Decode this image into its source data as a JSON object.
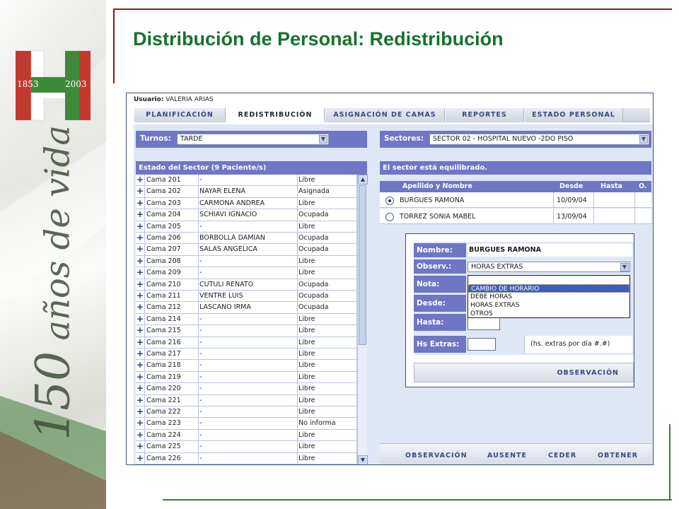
{
  "page": {
    "title": "Distribución de Personal: Redistribución"
  },
  "banner": {
    "years_left": "1853",
    "years_right": "2003",
    "caption_number": "150",
    "caption_text": "años de vida"
  },
  "app": {
    "user_label": "Usuario:",
    "user_name": "VALERIA ARIAS",
    "tabs": [
      {
        "label": "PLANIFICACIÓN",
        "active": false
      },
      {
        "label": "REDISTRIBUCIÓN",
        "active": true
      },
      {
        "label": "ASIGNACIÓN DE CAMAS",
        "active": false
      },
      {
        "label": "REPORTES",
        "active": false
      },
      {
        "label": "ESTADO PERSONAL",
        "active": false
      }
    ],
    "turnos_label": "Turnos:",
    "turnos_value": "TARDE",
    "sectores_label": "Sectores:",
    "sectores_value": "SECTOR 02 - HOSPITAL NUEVO -2DO PISO",
    "sector_status_title": "Estado del Sector (9 Paciente/s)",
    "balance_message": "El sector está equilibrado.",
    "beds": [
      {
        "cama": "Cama 201",
        "nombre": "-",
        "estado": "Libre"
      },
      {
        "cama": "Cama 202",
        "nombre": "NAYAR ELENA",
        "estado": "Asignada"
      },
      {
        "cama": "Cama 203",
        "nombre": "CARMONA ANDREA",
        "estado": "Libre"
      },
      {
        "cama": "Cama 204",
        "nombre": "SCHIAVI IGNACIO",
        "estado": "Ocupada"
      },
      {
        "cama": "Cama 205",
        "nombre": "-",
        "estado": "Libre"
      },
      {
        "cama": "Cama 206",
        "nombre": "BORBOLLA DAMIAN",
        "estado": "Ocupada"
      },
      {
        "cama": "Cama 207",
        "nombre": "SALAS ANGELICA",
        "estado": "Ocupada"
      },
      {
        "cama": "Cama 208",
        "nombre": "-",
        "estado": "Libre"
      },
      {
        "cama": "Cama 209",
        "nombre": "-",
        "estado": "Libre"
      },
      {
        "cama": "Cama 210",
        "nombre": "CUTULI RENATO",
        "estado": "Ocupada"
      },
      {
        "cama": "Cama 211",
        "nombre": "VENTRE LUIS",
        "estado": "Ocupada"
      },
      {
        "cama": "Cama 212",
        "nombre": "LASCANO IRMA",
        "estado": "Ocupada"
      },
      {
        "cama": "Cama 214",
        "nombre": "-",
        "estado": "Libre"
      },
      {
        "cama": "Cama 215",
        "nombre": "-",
        "estado": "Libre"
      },
      {
        "cama": "Cama 216",
        "nombre": "-",
        "estado": "Libre"
      },
      {
        "cama": "Cama 217",
        "nombre": "-",
        "estado": "Libre"
      },
      {
        "cama": "Cama 218",
        "nombre": "-",
        "estado": "Libre"
      },
      {
        "cama": "Cama 219",
        "nombre": "-",
        "estado": "Libre"
      },
      {
        "cama": "Cama 220",
        "nombre": "-",
        "estado": "Libre"
      },
      {
        "cama": "Cama 221",
        "nombre": "-",
        "estado": "Libre"
      },
      {
        "cama": "Cama 222",
        "nombre": "-",
        "estado": "Libre"
      },
      {
        "cama": "Cama 223",
        "nombre": "-",
        "estado": "No informa"
      },
      {
        "cama": "Cama 224",
        "nombre": "-",
        "estado": "Libre"
      },
      {
        "cama": "Cama 225",
        "nombre": "-",
        "estado": "Libre"
      },
      {
        "cama": "Cama 226",
        "nombre": "-",
        "estado": "Libre"
      }
    ],
    "staff_columns": [
      "Apellido y Nombre",
      "Desde",
      "Hasta",
      "O."
    ],
    "staff": [
      {
        "nombre": "BURGUES RAMONA",
        "desde": "10/09/04",
        "hasta": "",
        "o": "",
        "selected": true
      },
      {
        "nombre": "TORREZ SONIA MABEL",
        "desde": "13/09/04",
        "hasta": "",
        "o": "",
        "selected": false
      }
    ],
    "dialog": {
      "nombre_label": "Nombre:",
      "nombre_value": "BURGUES RAMONA",
      "observ_label": "Observ.:",
      "observ_value": "HORAS EXTRAS",
      "nota_label": "Nota:",
      "desde_label": "Desde:",
      "hasta_label": "Hasta:",
      "hs_extras_label": "Hs Extras:",
      "hs_extras_hint": "(hs. extras por día #.#)",
      "options": [
        "CAMBIO DE HORARIO",
        "DEBE HORAS",
        "HORAS EXTRAS",
        "OTROS"
      ],
      "selected_option": "CAMBIO DE HORARIO",
      "button": "OBSERVACIÓN"
    },
    "actions": [
      "OBSERVACIÓN",
      "AUSENTE",
      "CEDER",
      "OBTENER"
    ]
  },
  "colors": {
    "title_green": "#16722e",
    "frame_red": "#a01515",
    "frame_green": "#3f7a38",
    "header_blue": "#6d77c4",
    "panel_bg": "#dfe7f6"
  }
}
